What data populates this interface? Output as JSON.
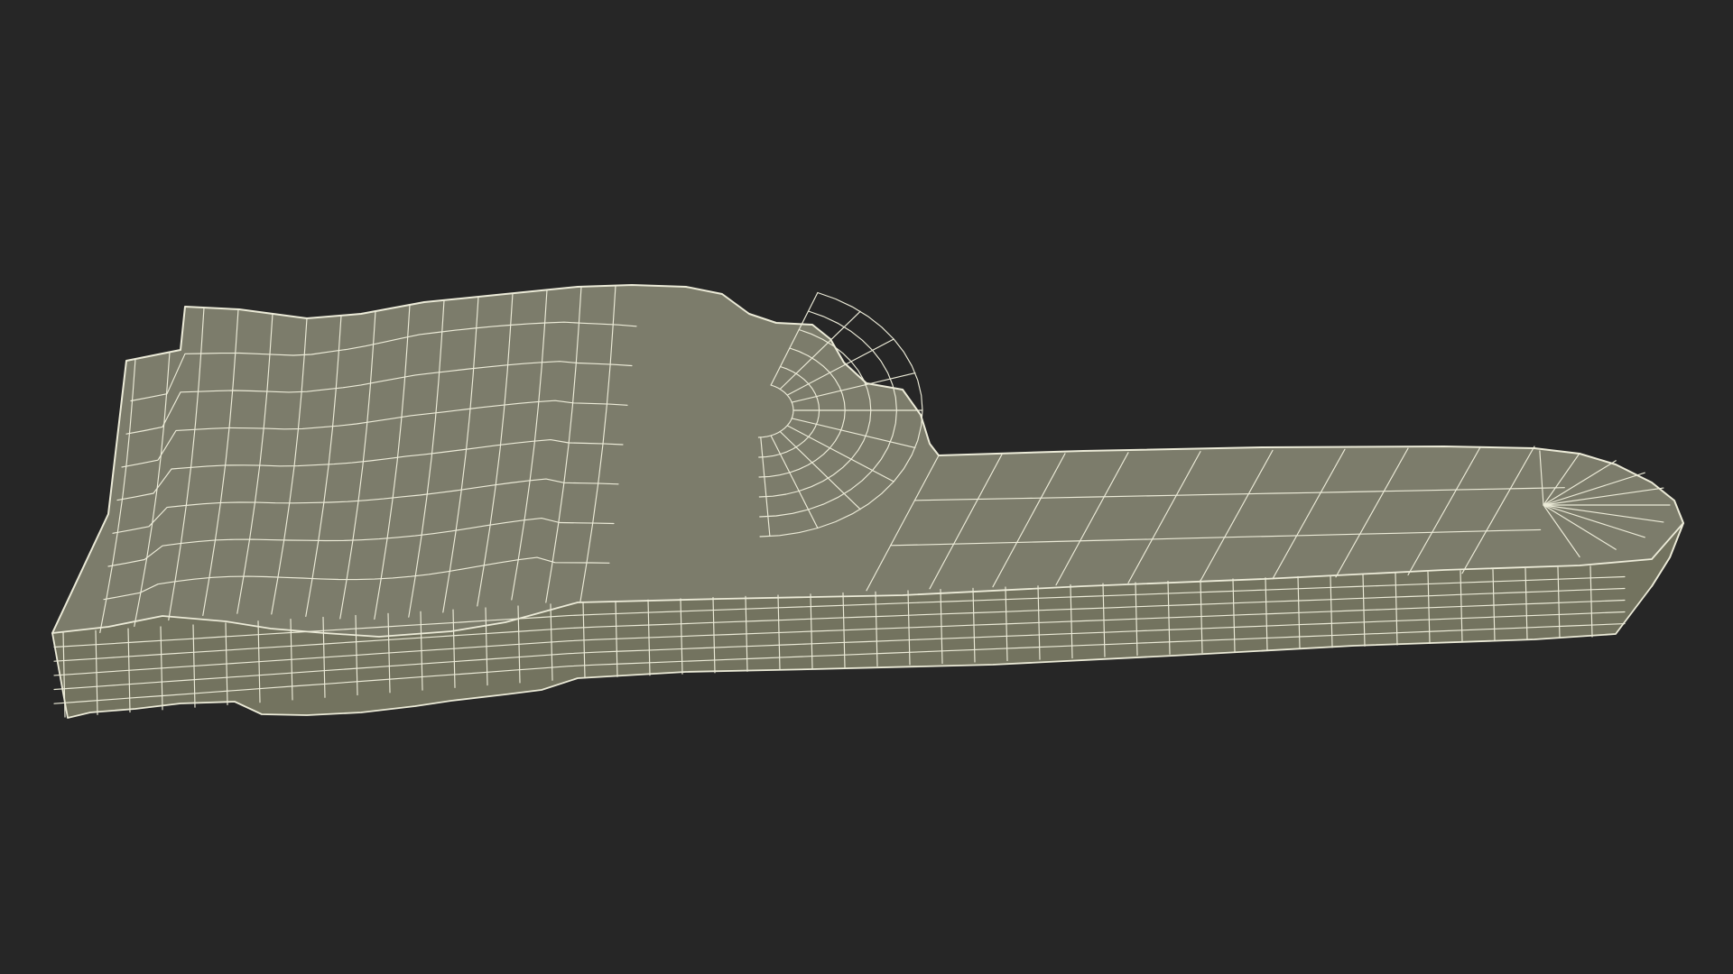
{
  "scene": {
    "background_color": "#262626",
    "subject": "wireframe-mesh",
    "mesh_fill_color": "#7c7c6b",
    "mesh_side_color": "#73735f",
    "wire_color": "#ecebd8"
  }
}
